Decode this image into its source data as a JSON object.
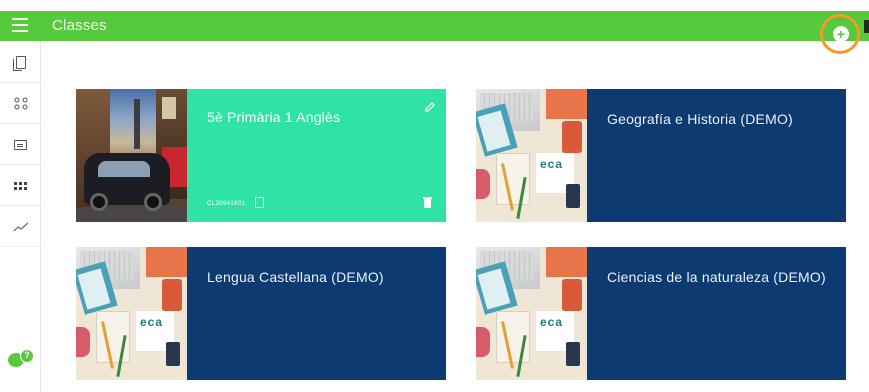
{
  "topbar": {
    "title": "Classes",
    "add_icon_glyph": "+",
    "color": "#56c93c"
  },
  "sidebar": {
    "items": [
      {
        "name": "books-icon"
      },
      {
        "name": "users-icon"
      },
      {
        "name": "messages-icon"
      },
      {
        "name": "apps-grid-icon"
      },
      {
        "name": "stats-trend-icon",
        "glyph": "〰"
      }
    ],
    "help_badge": "?"
  },
  "classes": [
    {
      "title": "5è Primària 1 Anglès",
      "code": "CL30941601",
      "color": "#2ee3a4",
      "image": "london-photo-icon",
      "active": true
    },
    {
      "title": "Geografía e Historia (DEMO)",
      "color": "#0d3a70",
      "image": "desk-photo-icon"
    },
    {
      "title": "Lengua Castellana (DEMO)",
      "color": "#0d3a70",
      "image": "desk-photo-icon"
    },
    {
      "title": "Ciencias de la naturaleza (DEMO)",
      "color": "#0d3a70",
      "image": "desk-photo-icon"
    }
  ],
  "desk_letters": "eca"
}
